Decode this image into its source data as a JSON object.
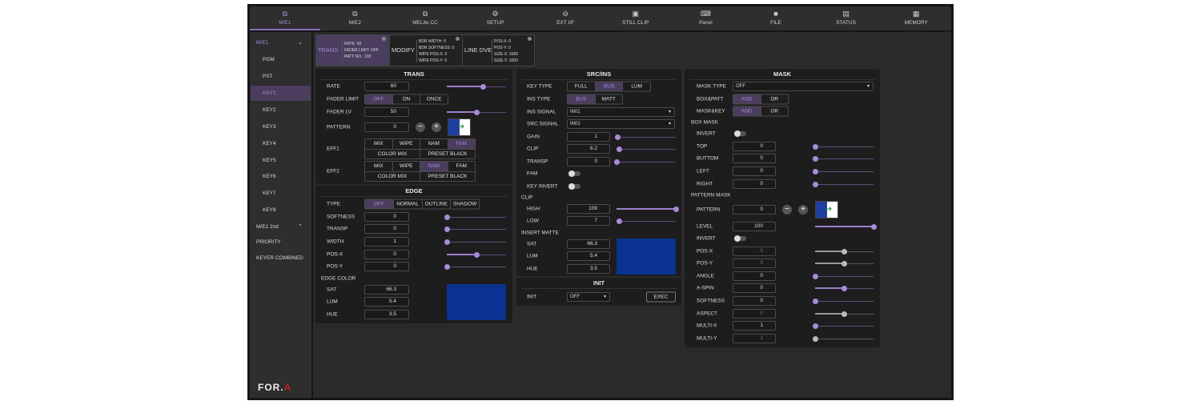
{
  "nav": [
    {
      "label": "M/E1",
      "icon": "layers-icon",
      "active": true
    },
    {
      "label": "M/E2",
      "icon": "layers-icon"
    },
    {
      "label": "MELite CC",
      "icon": "layers-icon"
    },
    {
      "label": "SETUP",
      "icon": "gear-icon"
    },
    {
      "label": "EXT I/F",
      "icon": "link-icon"
    },
    {
      "label": "STILL CLIP",
      "icon": "image-icon"
    },
    {
      "label": "Panel",
      "icon": "keyboard-icon"
    },
    {
      "label": "FILE",
      "icon": "folder-icon"
    },
    {
      "label": "STATUS",
      "icon": "document-icon"
    },
    {
      "label": "MEMORY",
      "icon": "grid-icon"
    }
  ],
  "sidebar": [
    {
      "label": "M/E1",
      "group": true,
      "chevron": "down"
    },
    {
      "label": "PGM"
    },
    {
      "label": "PST"
    },
    {
      "label": "KEY1",
      "active": true
    },
    {
      "label": "KEY2"
    },
    {
      "label": "KEY3"
    },
    {
      "label": "KEY4"
    },
    {
      "label": "KEY5"
    },
    {
      "label": "KEY6"
    },
    {
      "label": "KEY7"
    },
    {
      "label": "KEY8"
    },
    {
      "label": "M/E1 2nd",
      "group": true,
      "chevron": "up"
    },
    {
      "label": "PRIORITY",
      "group": true
    },
    {
      "label": "KEYER COMBINED",
      "group": true
    }
  ],
  "cards": [
    {
      "name": "TRANS",
      "active": true,
      "info": [
        "RATE: 60",
        "FADER LIMIT: OFF",
        "PATT NO.: 100"
      ]
    },
    {
      "name": "MODIFY",
      "info": [
        "BDR WIDTH: 0",
        "BDR SOFTNESS: 0",
        "WIPE POS-X: 0",
        "WIPE POS-Y: 0"
      ]
    },
    {
      "name": "LINE DVE",
      "info": [
        "POS-X: 0",
        "POS-Y: 0",
        "SIZE-X: 1000",
        "SIZE-Y: 1000"
      ]
    }
  ],
  "panels": {
    "trans": {
      "title": "TRANS",
      "rows": [
        {
          "type": "input",
          "label": "RATE",
          "value": "60",
          "slider": 0.61
        },
        {
          "type": "seg",
          "label": "FADER LIMIT",
          "options": [
            "OFF",
            "ON",
            "ONCE"
          ],
          "active": 0
        },
        {
          "type": "input",
          "label": "FADER LV",
          "value": "50",
          "slider": 0.5
        },
        {
          "type": "pattern",
          "label": "PATTERN",
          "value": "0"
        },
        {
          "type": "grid",
          "label": "EFF1",
          "row1": [
            "MIX",
            "WIPE",
            "NAM",
            "FAM"
          ],
          "row2": [
            "COLOR MIX",
            "PRESET BLACK"
          ],
          "active": "FAM"
        },
        {
          "type": "grid",
          "label": "EFF2",
          "row1": [
            "MIX",
            "WIPE",
            "NAM",
            "FAM"
          ],
          "row2": [
            "COLOR MIX",
            "PRESET BLACK"
          ],
          "active": "NAM"
        }
      ]
    },
    "edge": {
      "title": "EDGE",
      "color": "#0a3391",
      "rows": [
        {
          "type": "seg",
          "label": "TYPE",
          "options": [
            "OFF",
            "NORMAL",
            "OUTLINE",
            "SHADOW"
          ],
          "active": 0
        },
        {
          "type": "input",
          "label": "SOFTNESS",
          "value": "0",
          "slider": 0
        },
        {
          "type": "input",
          "label": "TRANSP",
          "value": "0",
          "slider": 0
        },
        {
          "type": "input",
          "label": "WIDTH",
          "value": "1",
          "slider": 0
        },
        {
          "type": "input",
          "label": "POS-X",
          "value": "0",
          "slider": 0.5
        },
        {
          "type": "input",
          "label": "POS-Y",
          "value": "0",
          "slider": 0
        },
        {
          "type": "section",
          "label": "EDGE COLOR"
        },
        {
          "type": "input",
          "label": "SAT",
          "value": "66.3"
        },
        {
          "type": "input",
          "label": "LUM",
          "value": "5.4"
        },
        {
          "type": "input",
          "label": "HUE",
          "value": "3.5"
        }
      ]
    },
    "src": {
      "title": "SRC/INS",
      "color": "#0a3391",
      "rows": [
        {
          "type": "seg",
          "label": "KEY TYPE",
          "options": [
            "FULL",
            "BUS",
            "LUM"
          ],
          "active": 1
        },
        {
          "type": "seg",
          "label": "INS TYPE",
          "options": [
            "BUS",
            "MATT"
          ],
          "active": 0
        },
        {
          "type": "select",
          "label": "INS SIGNAL",
          "value": "IN01"
        },
        {
          "type": "select",
          "label": "SRC SIGNAL",
          "value": "IN01"
        },
        {
          "type": "input",
          "label": "GAIN",
          "value": "1",
          "slider": 0.02
        },
        {
          "type": "input",
          "label": "CLIP",
          "value": "6.2",
          "slider": 0.05
        },
        {
          "type": "input",
          "label": "TRANSP",
          "value": "0",
          "slider": 0
        },
        {
          "type": "toggle",
          "label": "FAM",
          "on": false
        },
        {
          "type": "toggle",
          "label": "KEY INVERT",
          "on": false
        },
        {
          "type": "section",
          "label": "CLIP"
        },
        {
          "type": "input",
          "label": "HIGH",
          "value": "109",
          "slider": 1
        },
        {
          "type": "input",
          "label": "LOW",
          "value": "7",
          "slider": 0.05
        },
        {
          "type": "section",
          "label": "INSERT MATTE"
        },
        {
          "type": "input",
          "label": "SAT",
          "value": "66.3"
        },
        {
          "type": "input",
          "label": "LUM",
          "value": "5.4"
        },
        {
          "type": "input",
          "label": "HUE",
          "value": "3.5"
        }
      ]
    },
    "init": {
      "title": "INIT",
      "rows": [
        {
          "type": "select",
          "label": "INIT",
          "value": "OFF",
          "exec": "EXEC"
        }
      ]
    },
    "mask": {
      "title": "MASK",
      "rows": [
        {
          "type": "select",
          "label": "MASK TYPE",
          "value": "OFF"
        },
        {
          "type": "seg",
          "label": "BOX&PATT",
          "options": [
            "AND",
            "OR"
          ],
          "active": 0
        },
        {
          "type": "seg",
          "label": "MASK&KEY",
          "options": [
            "AND",
            "OR"
          ],
          "active": 0
        },
        {
          "type": "section",
          "label": "BOX MASK"
        },
        {
          "type": "toggle",
          "label": "INVERT",
          "on": false
        },
        {
          "type": "input",
          "label": "TOP",
          "value": "0",
          "slider": 0
        },
        {
          "type": "input",
          "label": "BUTTOM",
          "value": "0",
          "slider": 0
        },
        {
          "type": "input",
          "label": "LEFT",
          "value": "0",
          "slider": 0
        },
        {
          "type": "input",
          "label": "RIGHT",
          "value": "0",
          "slider": 0
        },
        {
          "type": "section",
          "label": "PATTERN MASK"
        },
        {
          "type": "pattern",
          "label": "PATTERN",
          "value": "0"
        },
        {
          "type": "input",
          "label": "LEVEL",
          "value": "100",
          "slider": 1
        },
        {
          "type": "toggle",
          "label": "INVERT",
          "on": false
        },
        {
          "type": "input",
          "label": "POS-X",
          "value": "0",
          "slider": 0.5,
          "disabled": true
        },
        {
          "type": "input",
          "label": "POS-Y",
          "value": "0",
          "slider": 0.5,
          "disabled": true
        },
        {
          "type": "input",
          "label": "ANGLE",
          "value": "0",
          "slider": 0
        },
        {
          "type": "input",
          "label": "A-SPIN",
          "value": "0",
          "slider": 0.5
        },
        {
          "type": "input",
          "label": "SOFTNESS",
          "value": "0",
          "slider": 0
        },
        {
          "type": "input",
          "label": "ASPECT",
          "value": "0",
          "slider": 0.5,
          "disabled": true
        },
        {
          "type": "input",
          "label": "MULTI-X",
          "value": "1",
          "slider": 0
        },
        {
          "type": "input",
          "label": "MULTI-Y",
          "value": "1",
          "slider": 0,
          "disabled": true
        }
      ]
    }
  },
  "logo": {
    "text": "FOR.",
    "mark": "A"
  }
}
